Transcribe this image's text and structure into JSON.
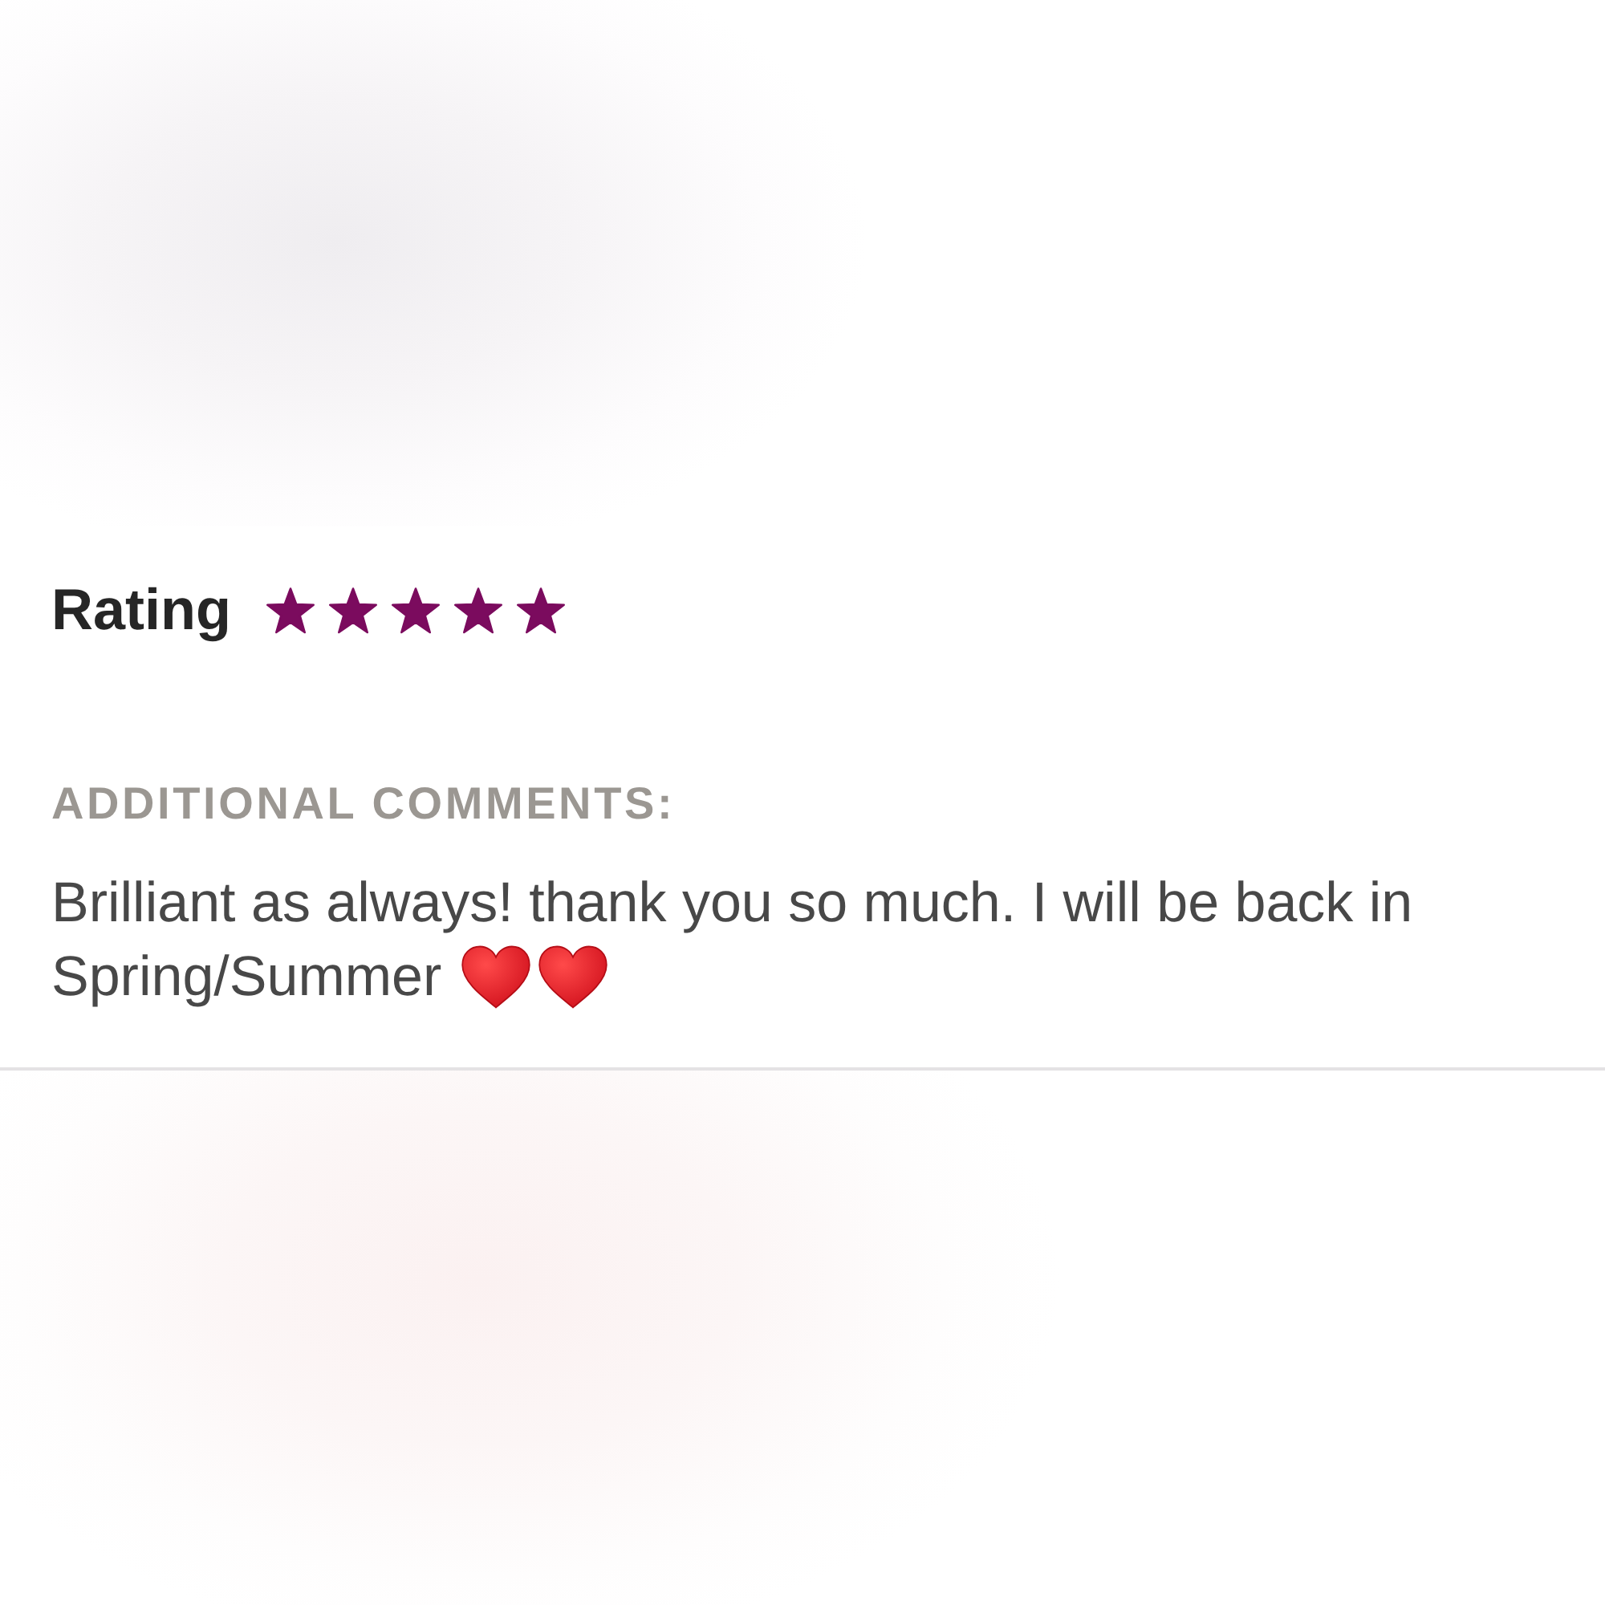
{
  "rating": {
    "label": "Rating",
    "stars": 5
  },
  "comments": {
    "heading": "ADDITIONAL COMMENTS:",
    "lines": [
      "Brilliant as always! thank you so much. I will be back in",
      "Spring/Summer"
    ],
    "emoji": [
      {
        "kind": "heart"
      },
      {
        "kind": "heart"
      }
    ]
  }
}
